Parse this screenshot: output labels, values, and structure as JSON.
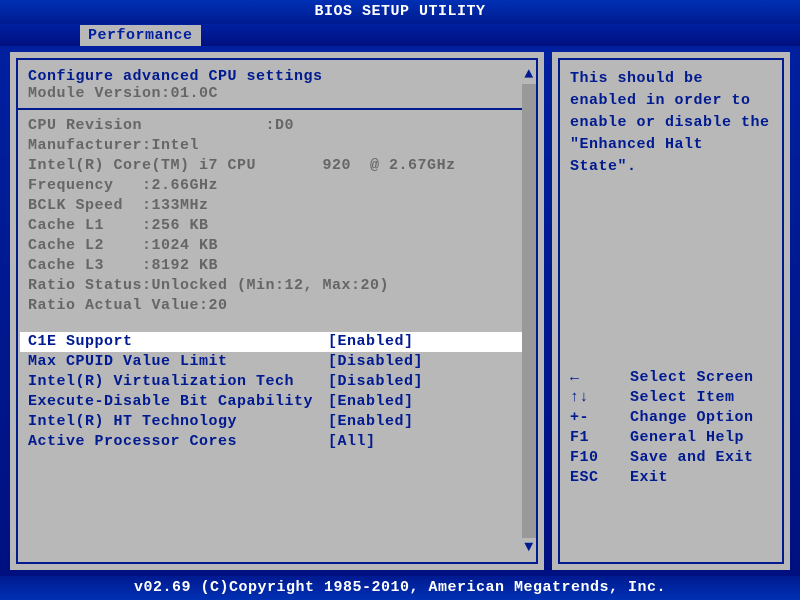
{
  "header": {
    "title": "BIOS SETUP UTILITY"
  },
  "tabs": {
    "active": "Performance"
  },
  "main": {
    "section_title": "Configure advanced CPU settings",
    "module_version": "Module Version:01.0C",
    "info": [
      "CPU Revision             :D0",
      "Manufacturer:Intel",
      "Intel(R) Core(TM) i7 CPU       920  @ 2.67GHz",
      "Frequency   :2.66GHz",
      "BCLK Speed  :133MHz",
      "Cache L1    :256 KB",
      "Cache L2    :1024 KB",
      "Cache L3    :8192 KB",
      "Ratio Status:Unlocked (Min:12, Max:20)",
      "Ratio Actual Value:20"
    ],
    "options": [
      {
        "label": "C1E Support",
        "value": "[Enabled]",
        "selected": true
      },
      {
        "label": "Max CPUID Value Limit",
        "value": "[Disabled]",
        "selected": false
      },
      {
        "label": "Intel(R) Virtualization Tech",
        "value": "[Disabled]",
        "selected": false
      },
      {
        "label": "Execute-Disable Bit Capability",
        "value": "[Enabled]",
        "selected": false
      },
      {
        "label": "Intel(R) HT Technology",
        "value": "[Enabled]",
        "selected": false
      },
      {
        "label": "Active Processor Cores",
        "value": "[All]",
        "selected": false
      }
    ]
  },
  "help": {
    "text": "This should be enabled in order to enable or disable the \"Enhanced Halt State\".",
    "keys": [
      {
        "k": "←",
        "d": "Select Screen"
      },
      {
        "k": "↑↓",
        "d": "Select Item"
      },
      {
        "k": "+-",
        "d": "Change Option"
      },
      {
        "k": "F1",
        "d": "General Help"
      },
      {
        "k": "F10",
        "d": "Save and Exit"
      },
      {
        "k": "ESC",
        "d": "Exit"
      }
    ]
  },
  "footer": {
    "text": "v02.69 (C)Copyright 1985-2010, American Megatrends, Inc."
  }
}
